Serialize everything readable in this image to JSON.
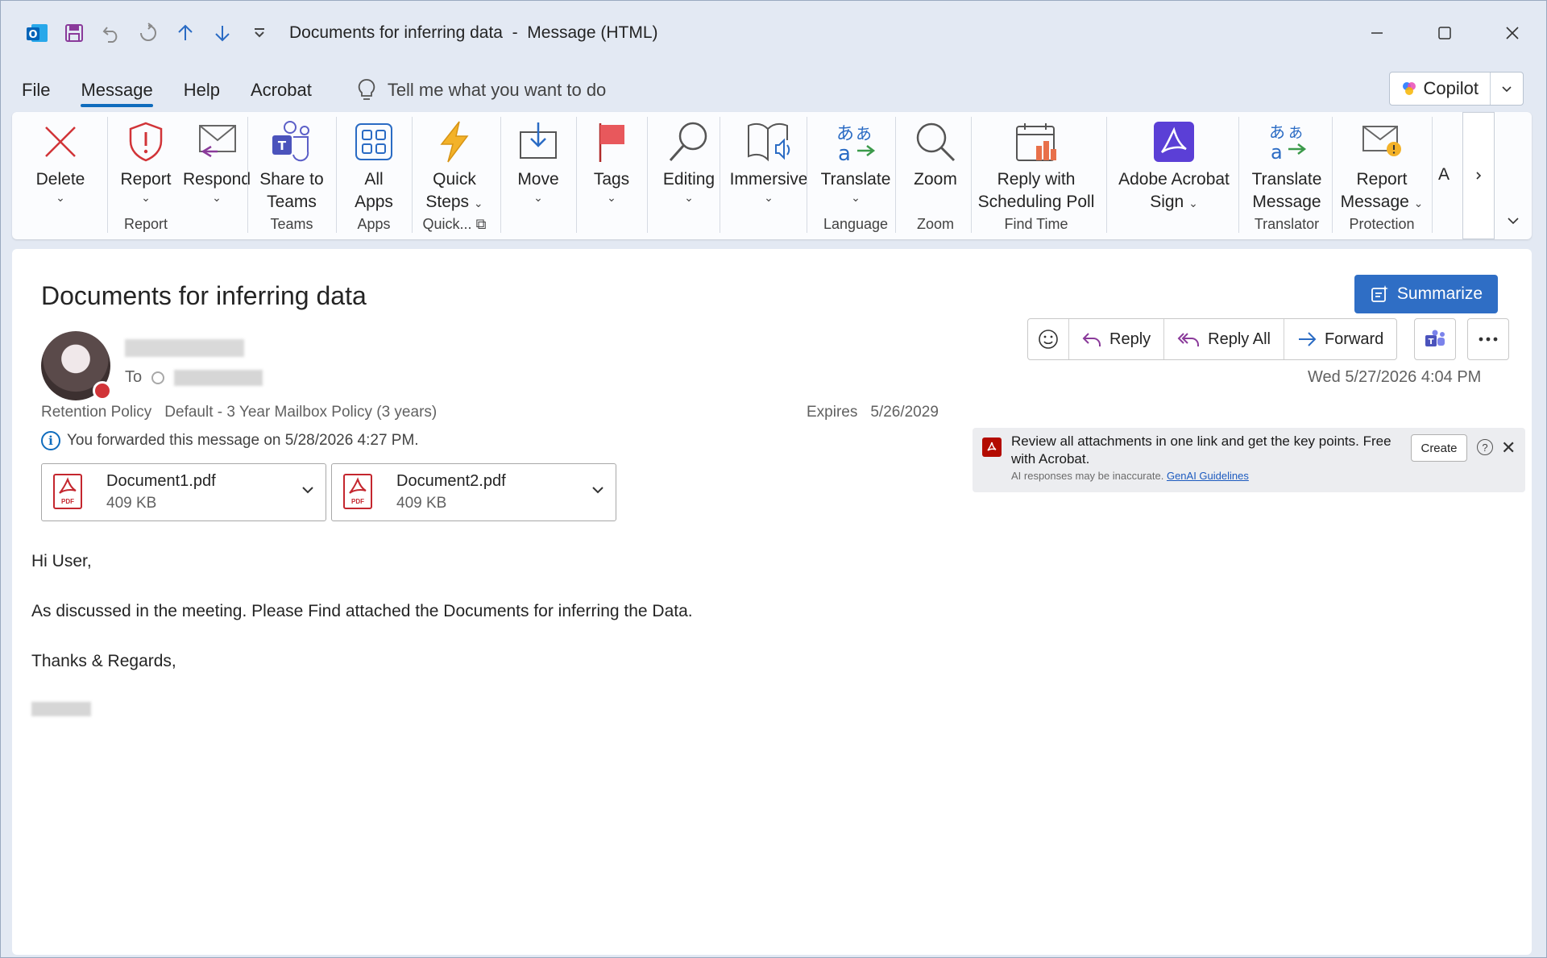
{
  "window": {
    "title": "Documents for inferring data  -  Message (HTML)"
  },
  "qat": {
    "icons": [
      "outlook-icon",
      "save-icon",
      "undo-icon",
      "redo-icon",
      "up-arrow-icon",
      "down-arrow-icon",
      "customize-icon"
    ]
  },
  "menu": {
    "tabs": [
      "File",
      "Message",
      "Help",
      "Acrobat"
    ],
    "active": "Message",
    "tellme": "Tell me what you want to do",
    "copilot": "Copilot"
  },
  "ribbon": {
    "delete": "Delete",
    "report": "Report",
    "report_group": "Report",
    "respond": "Respond",
    "share_teams_1": "Share to",
    "share_teams_2": "Teams",
    "teams_group": "Teams",
    "all_apps_1": "All",
    "all_apps_2": "Apps",
    "apps_group": "Apps",
    "quick_steps_1": "Quick",
    "quick_steps_2": "Steps",
    "quick_group": "Quick...",
    "move": "Move",
    "tags": "Tags",
    "editing": "Editing",
    "immersive": "Immersive",
    "translate": "Translate",
    "language_group": "Language",
    "zoom": "Zoom",
    "zoom_group": "Zoom",
    "reply_poll_1": "Reply with",
    "reply_poll_2": "Scheduling Poll",
    "findtime_group": "Find Time",
    "acrobat_sign_1": "Adobe Acrobat",
    "acrobat_sign_2": "Sign",
    "translate_msg_1": "Translate",
    "translate_msg_2": "Message",
    "translator_group": "Translator",
    "report_msg_1": "Report",
    "report_msg_2": "Message",
    "protection_group": "Protection",
    "truncated": "A"
  },
  "message": {
    "subject": "Documents for inferring data",
    "summarize": "Summarize",
    "to_label": "To",
    "retention_label": "Retention Policy",
    "retention_value": "Default - 3 Year Mailbox Policy (3 years)",
    "expires_label": "Expires",
    "expires_value": "5/26/2029",
    "forwarded_note": "You forwarded this message on 5/28/2026 4:27 PM.",
    "date": "Wed 5/27/2026 4:04 PM",
    "actions": {
      "reply": "Reply",
      "reply_all": "Reply All",
      "forward": "Forward"
    },
    "attachments": [
      {
        "name": "Document1.pdf",
        "size": "409 KB"
      },
      {
        "name": "Document2.pdf",
        "size": "409 KB"
      }
    ],
    "pdf_tag": "PDF",
    "acrobat_banner": {
      "text": "Review all attachments in one link and get the key points. Free with Acrobat.",
      "disclaimer": "AI responses may be inaccurate.",
      "link": "GenAI Guidelines",
      "create": "Create"
    },
    "body": {
      "greeting": "Hi User,",
      "line1": "As discussed in the meeting. Please Find attached the Documents for inferring the Data.",
      "closing": "Thanks & Regards,"
    }
  },
  "colors": {
    "accent": "#0f6cbd",
    "summarize_bg": "#2f6ec5",
    "delete_red": "#d13438",
    "frame_bg": "#e3e9f3"
  }
}
